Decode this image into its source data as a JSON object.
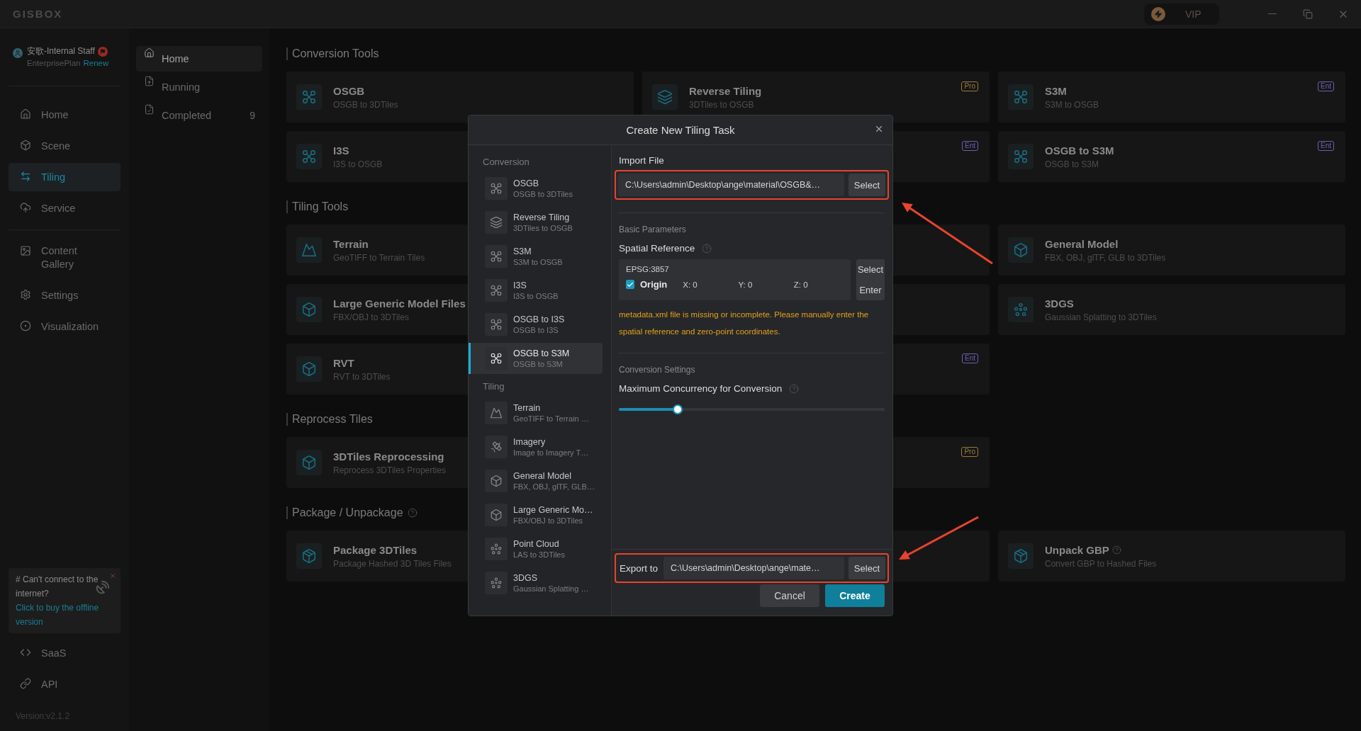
{
  "title_bar": {
    "logo": "GISBOX",
    "vip": "VIP"
  },
  "user": {
    "name": "安歌-Internal Staff",
    "plan": "EnterprisePlan",
    "renew": "Renew"
  },
  "nav": [
    {
      "label": "Home",
      "selected": false
    },
    {
      "label": "Scene",
      "selected": false
    },
    {
      "label": "Tiling",
      "selected": true
    },
    {
      "label": "Service",
      "selected": false
    },
    {
      "label": "Content Gallery",
      "selected": false
    },
    {
      "label": "Settings",
      "selected": false
    },
    {
      "label": "Visualization",
      "selected": false
    }
  ],
  "offline_banner": {
    "text": "# Can't connect to the internet?",
    "link": "Click to buy the offline version"
  },
  "nav_bottom": [
    {
      "label": "SaaS",
      "selected": false
    },
    {
      "label": "API",
      "selected": false
    }
  ],
  "version": "Version:v2.1.2",
  "task_menu": [
    {
      "label": "Home",
      "selected": true
    },
    {
      "label": "Running",
      "selected": false
    },
    {
      "label": "Completed",
      "count": "9",
      "selected": false
    }
  ],
  "sections": [
    {
      "title": "Conversion Tools",
      "help": false,
      "cards": [
        {
          "kind": "tool",
          "title": "OSGB",
          "subtitle": "OSGB to 3DTiles"
        },
        {
          "kind": "tool",
          "title": "Reverse Tiling",
          "subtitle": "3DTiles to OSGB",
          "badge": {
            "label": "Pro",
            "color": "#9a7a3a"
          }
        },
        {
          "kind": "tool",
          "title": "S3M",
          "subtitle": "S3M to OSGB",
          "badge": {
            "label": "Ent",
            "color": "#6d5fb0"
          }
        },
        {
          "kind": "tool",
          "title": "I3S",
          "subtitle": "I3S to OSGB"
        },
        {
          "kind": "covered",
          "badge": {
            "label": "Ent",
            "color": "#6d5fb0"
          }
        },
        {
          "kind": "tool",
          "title": "OSGB to S3M",
          "subtitle": "OSGB to S3M",
          "badge": {
            "label": "Ent",
            "color": "#6d5fb0"
          }
        }
      ]
    },
    {
      "title": "Tiling Tools",
      "help": false,
      "cards": [
        {
          "kind": "tool",
          "title": "Terrain",
          "subtitle": "GeoTIFF to Terrain Tiles"
        },
        {
          "kind": "covered"
        },
        {
          "kind": "tool",
          "title": "General Model",
          "subtitle": "FBX, OBJ, glTF, GLB to 3DTiles"
        },
        {
          "kind": "tool",
          "title": "Large Generic Model Files",
          "subtitle": "FBX/OBJ to 3DTiles"
        },
        {
          "kind": "covered"
        },
        {
          "kind": "tool",
          "title": "3DGS",
          "subtitle": "Gaussian Splatting to 3DTiles"
        },
        {
          "kind": "tool",
          "title": "RVT",
          "subtitle": "RVT to 3DTiles"
        },
        {
          "kind": "covered",
          "badge": {
            "label": "Ent",
            "color": "#6d5fb0"
          }
        }
      ]
    },
    {
      "title": "Reprocess Tiles",
      "help": false,
      "cards": [
        {
          "kind": "tool",
          "title": "3DTiles Reprocessing",
          "subtitle": "Reprocess 3DTiles Properties"
        },
        {
          "kind": "covered",
          "badge": {
            "label": "Pro",
            "color": "#9a7a3a"
          }
        }
      ]
    },
    {
      "title": "Package / Unpackage",
      "help": true,
      "cards": [
        {
          "kind": "tool",
          "title": "Package 3DTiles",
          "subtitle": "Package Hashed 3D Tiles Files"
        },
        {
          "kind": "covered"
        },
        {
          "kind": "tool",
          "title": "Unpack GBP",
          "subtitle": "Convert GBP to Hashed Files",
          "help": true
        }
      ]
    }
  ],
  "dialog": {
    "title": "Create New Tiling Task",
    "groups": [
      {
        "title": "Conversion",
        "items": [
          {
            "title": "OSGB",
            "subtitle": "OSGB to 3DTiles",
            "selected": false
          },
          {
            "title": "Reverse Tiling",
            "subtitle": "3DTiles to OSGB",
            "selected": false
          },
          {
            "title": "S3M",
            "subtitle": "S3M to OSGB",
            "selected": false
          },
          {
            "title": "I3S",
            "subtitle": "I3S to OSGB",
            "selected": false
          },
          {
            "title": "OSGB to I3S",
            "subtitle": "OSGB to I3S",
            "selected": false
          },
          {
            "title": "OSGB to S3M",
            "subtitle": "OSGB to S3M",
            "selected": true
          }
        ]
      },
      {
        "title": "Tiling",
        "items": [
          {
            "title": "Terrain",
            "subtitle": "GeoTIFF to Terrain …",
            "selected": false
          },
          {
            "title": "Imagery",
            "subtitle": "Image to Imagery T…",
            "selected": false
          },
          {
            "title": "General Model",
            "subtitle": "FBX, OBJ, glTF, GLB…",
            "selected": false
          },
          {
            "title": "Large Generic Mo…",
            "subtitle": "FBX/OBJ to 3DTiles",
            "selected": false
          },
          {
            "title": "Point Cloud",
            "subtitle": "LAS to 3DTiles",
            "selected": false
          },
          {
            "title": "3DGS",
            "subtitle": "Gaussian Splatting …",
            "selected": false
          }
        ]
      }
    ],
    "import": {
      "label": "Import File",
      "value": "C:\\Users\\admin\\Desktop\\ange\\material\\OSGB&…",
      "button": "Select",
      "highlighted": true
    },
    "basic": {
      "heading": "Basic Parameters",
      "label": "Spatial Reference",
      "epsg": "EPSG:3857",
      "origin": {
        "label": "Origin",
        "checked": true
      },
      "coords": [
        {
          "axis": "X:",
          "value": "0"
        },
        {
          "axis": "Y:",
          "value": "0"
        },
        {
          "axis": "Z:",
          "value": "0"
        }
      ],
      "select": "Select",
      "enter": "Enter",
      "warning": "metadata.xml file is missing or incomplete. Please manually enter the spatial reference and zero-point coordinates."
    },
    "conversion": {
      "heading": "Conversion Settings",
      "label": "Maximum Concurrency for Conversion",
      "level": 0.22
    },
    "export": {
      "label": "Export to",
      "value": "C:\\Users\\admin\\Desktop\\ange\\mate…",
      "button": "Select",
      "highlighted": true
    },
    "buttons": [
      {
        "label": "Cancel",
        "kind": "secondary"
      },
      {
        "label": "Create",
        "kind": "primary"
      }
    ]
  }
}
